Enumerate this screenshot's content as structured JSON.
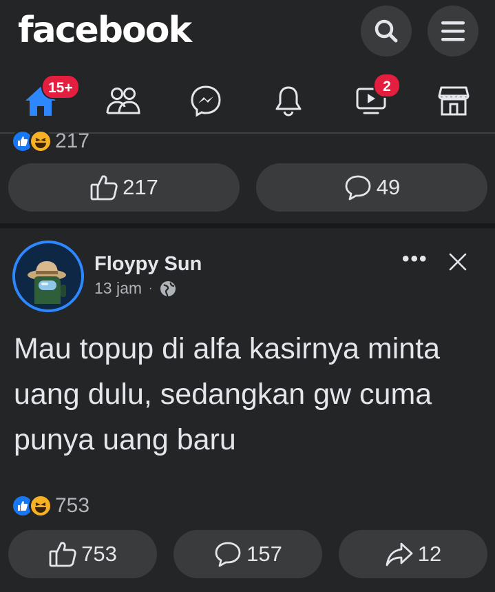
{
  "header": {
    "logo": "facebook",
    "nav": {
      "home_badge": "15+",
      "video_badge": "2"
    }
  },
  "posts": [
    {
      "reaction_count_partial": "217",
      "like_count": "217",
      "comment_count": "49"
    },
    {
      "author": "Floypy Sun",
      "time": "13 jam",
      "separator": "·",
      "more_label": "•••",
      "text": "Mau topup di alfa kasirnya minta uang dulu, sedangkan gw cuma punya uang baru",
      "reaction_count": "753",
      "like_count": "753",
      "comment_count": "157",
      "share_count": "12"
    }
  ],
  "colors": {
    "background": "#18191a",
    "surface": "#242526",
    "button": "#3a3b3c",
    "accent": "#1877f2",
    "badge": "#e41e3f",
    "text_primary": "#e4e6eb",
    "text_secondary": "#b0b3b8"
  },
  "icons": [
    "search-icon",
    "menu-icon",
    "home-icon",
    "friends-icon",
    "messenger-icon",
    "bell-icon",
    "video-icon",
    "marketplace-icon",
    "like-icon",
    "comment-icon",
    "share-icon",
    "globe-icon",
    "close-icon"
  ]
}
